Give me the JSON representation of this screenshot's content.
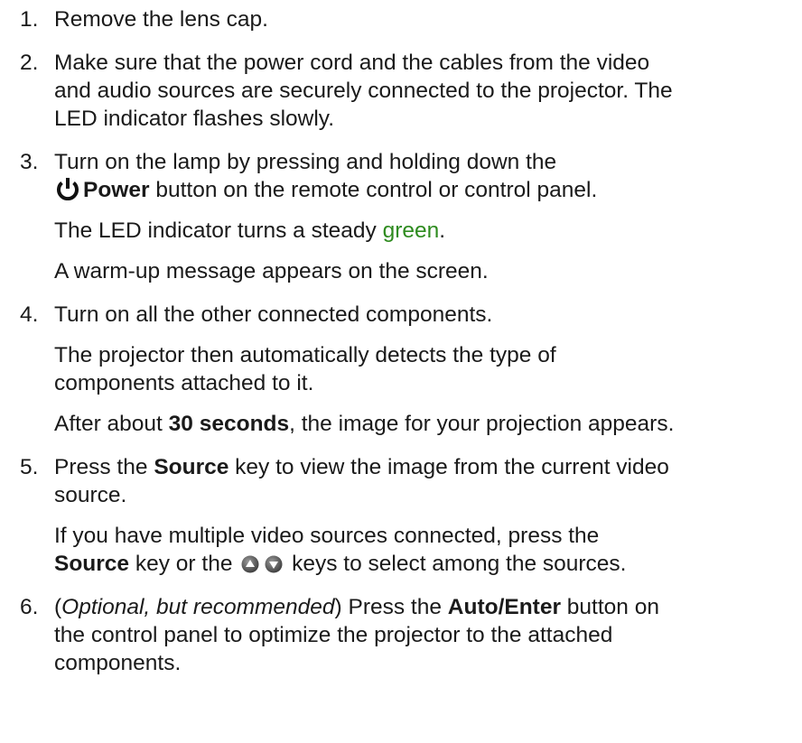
{
  "steps": [
    {
      "num": "1.",
      "p1": "Remove the lens cap."
    },
    {
      "num": "2.",
      "p1_line1": "Make sure that the power cord and the cables from the video",
      "p1_line2": "and audio sources are securely connected to the projector. The",
      "p1_line3": "LED indicator flashes slowly."
    },
    {
      "num": "3.",
      "p1_line1": "Turn on the lamp by pressing and holding down the",
      "power_label": "Power",
      "p1_line2_rest": " button on the remote control or control panel.",
      "p2_before": "The LED indicator turns a steady ",
      "p2_green": "green",
      "p2_after": ".",
      "p3": "A warm-up message appears on the screen."
    },
    {
      "num": "4.",
      "p1": "Turn on all the other connected components.",
      "p2_line1": "The projector then automatically detects the type of",
      "p2_line2": "components attached to it.",
      "p3_before": "After about ",
      "p3_bold": "30 seconds",
      "p3_after": ", the image for your projection appears."
    },
    {
      "num": "5.",
      "p1_before": "Press the ",
      "p1_bold": "Source",
      "p1_after": " key to view the image from the current video",
      "p1_line2": "source.",
      "p2_line1": "If you have multiple video sources connected, press the",
      "p2_bold": "Source",
      "p2_mid": " key or the",
      "p2_after": "keys to select among the sources."
    },
    {
      "num": "6.",
      "p1_open": "(",
      "p1_italic": "Optional, but recommended",
      "p1_close": ") Press the ",
      "p1_bold": "Auto/Enter",
      "p1_after": " button on",
      "p1_line2": "the control panel to optimize the projector to the attached",
      "p1_line3": "components."
    }
  ],
  "colors": {
    "text": "#1a1a1a",
    "green": "#2e8b1f"
  },
  "icons": {
    "power": "power-icon",
    "up": "up-arrow-button-icon",
    "down": "down-arrow-button-icon"
  }
}
